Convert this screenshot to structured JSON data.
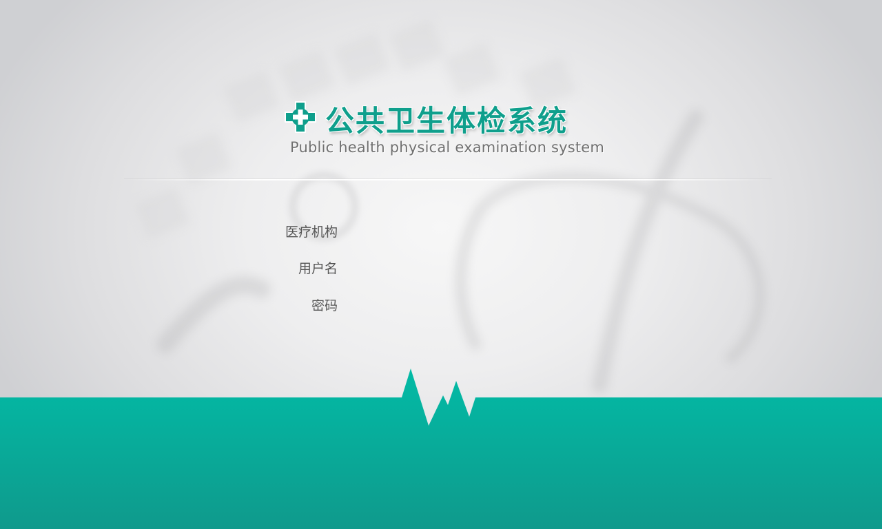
{
  "header": {
    "title": "公共卫生体检系统",
    "subtitle": "Public health physical examination system",
    "logo_icon": "medical-cross-icon"
  },
  "login_form": {
    "fields": [
      {
        "label": "医疗机构",
        "value": ""
      },
      {
        "label": "用户名",
        "value": ""
      },
      {
        "label": "密码",
        "value": ""
      }
    ]
  },
  "colors": {
    "brand_teal": "#0f9f8c",
    "band_top": "#02bba6",
    "band_bottom": "#0f9a8c",
    "label_text": "#555555",
    "subtitle_text": "#707070"
  }
}
